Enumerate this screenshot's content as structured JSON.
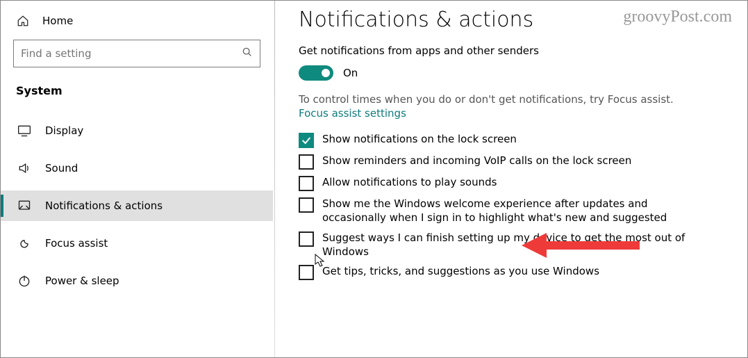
{
  "sidebar": {
    "home_label": "Home",
    "search_placeholder": "Find a setting",
    "section_title": "System",
    "items": [
      {
        "label": "Display",
        "icon": "display"
      },
      {
        "label": "Sound",
        "icon": "sound"
      },
      {
        "label": "Notifications & actions",
        "icon": "notifications"
      },
      {
        "label": "Focus assist",
        "icon": "focus"
      },
      {
        "label": "Power & sleep",
        "icon": "power"
      }
    ],
    "selected_index": 2
  },
  "main": {
    "title": "Notifications & actions",
    "subhead": "Get notifications from apps and other senders",
    "toggle_state": "On",
    "hint": "To control times when you do or don't get notifications, try Focus assist.",
    "link": "Focus assist settings",
    "options": [
      {
        "label": "Show notifications on the lock screen",
        "checked": true
      },
      {
        "label": "Show reminders and incoming VoIP calls on the lock screen",
        "checked": false
      },
      {
        "label": "Allow notifications to play sounds",
        "checked": false
      },
      {
        "label": "Show me the Windows welcome experience after updates and occasionally when I sign in to highlight what's new and suggested",
        "checked": false
      },
      {
        "label": "Suggest ways I can finish setting up my device to get the most out of Windows",
        "checked": false
      },
      {
        "label": "Get tips, tricks, and suggestions as you use Windows",
        "checked": false
      }
    ]
  },
  "watermark": "groovyPost.com"
}
